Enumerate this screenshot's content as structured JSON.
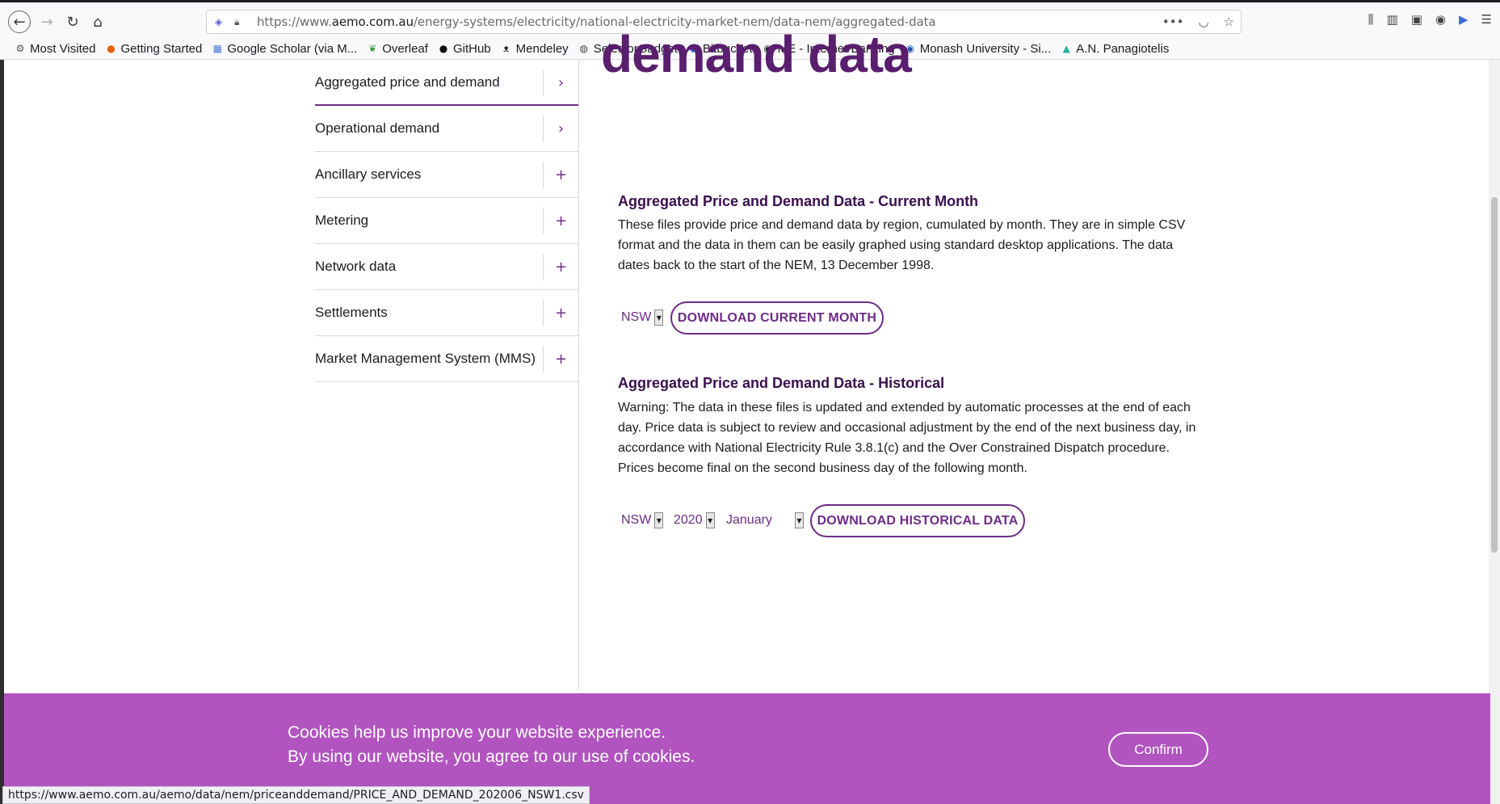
{
  "browser": {
    "url_prefix": "https://www.",
    "url_domain": "aemo.com.au",
    "url_path": "/energy-systems/electricity/national-electricity-market-nem/data-nem/aggregated-data",
    "bookmarks": [
      {
        "label": "Most Visited",
        "icon": "gear-icon"
      },
      {
        "label": "Getting Started",
        "icon": "firefox-icon"
      },
      {
        "label": "Google Scholar (via M...",
        "icon": "scholar-icon"
      },
      {
        "label": "Overleaf",
        "icon": "overleaf-icon"
      },
      {
        "label": "GitHub",
        "icon": "github-icon"
      },
      {
        "label": "Mendeley",
        "icon": "mendeley-icon"
      },
      {
        "label": "SelectorGadget",
        "icon": "globe-icon"
      },
      {
        "label": "Bitbucket",
        "icon": "bitbucket-icon"
      },
      {
        "label": "ME - Internet Banking",
        "icon": "bank-icon"
      },
      {
        "label": "Monash University - Si...",
        "icon": "monash-icon"
      },
      {
        "label": "A.N. Panagiotelis",
        "icon": "person-icon"
      }
    ]
  },
  "hero_fragment": "demand data",
  "sidebar": {
    "items": [
      {
        "label": "Aggregated price and demand",
        "expander": "›",
        "active": true
      },
      {
        "label": "Operational demand",
        "expander": "›"
      },
      {
        "label": "Ancillary services",
        "expander": "+"
      },
      {
        "label": "Metering",
        "expander": "+"
      },
      {
        "label": "Network data",
        "expander": "+"
      },
      {
        "label": "Settlements",
        "expander": "+"
      },
      {
        "label": "Market Management System (MMS)",
        "expander": "+"
      }
    ]
  },
  "current": {
    "heading": "Aggregated Price and Demand Data - Current Month",
    "body": "These files provide price and demand data by region, cumulated by month. They are in simple CSV format and the data in them can be easily graphed using standard desktop applications. The data dates back to the start of the NEM, 13 December 1998.",
    "region": "NSW",
    "button": "DOWNLOAD CURRENT MONTH"
  },
  "historical": {
    "heading": "Aggregated Price and Demand Data - Historical",
    "body": "Warning: The data in these files is updated and extended by automatic processes at the end of each day. Price data is subject to review and occasional adjustment by the end of the next business day, in accordance with National Electricity Rule 3.8.1(c) and the Over Constrained Dispatch procedure. Prices become final on the second business day of the following month.",
    "region": "NSW",
    "year": "2020",
    "month": "January",
    "button": "DOWNLOAD HISTORICAL DATA"
  },
  "cookie": {
    "line1": "Cookies help us improve your website experience.",
    "line2": "By using our website, you agree to our use of cookies.",
    "confirm": "Confirm"
  },
  "status_url": "https://www.aemo.com.au/aemo/data/nem/priceanddemand/PRICE_AND_DEMAND_202006_NSW1.csv"
}
